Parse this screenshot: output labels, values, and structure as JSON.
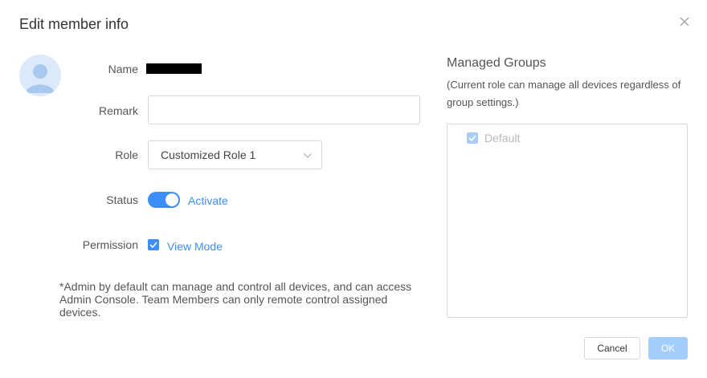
{
  "dialog": {
    "title": "Edit member info"
  },
  "form": {
    "name_label": "Name",
    "remark_label": "Remark",
    "remark_value": "",
    "role_label": "Role",
    "role_value": "Customized Role 1",
    "status_label": "Status",
    "status_text": "Activate",
    "status_on": true,
    "permission_label": "Permission",
    "permission_text": "View Mode",
    "permission_checked": true,
    "note": "*Admin by default can manage and control all devices, and can access Admin Console. Team Members can only remote control assigned devices."
  },
  "groups": {
    "title": "Managed Groups",
    "subtitle": "(Current role can manage all devices regardless of group settings.)",
    "items": [
      {
        "label": "Default",
        "checked": true,
        "disabled": true
      }
    ]
  },
  "footer": {
    "cancel_label": "Cancel",
    "ok_label": "OK"
  },
  "colors": {
    "accent": "#3d8ef8",
    "ok_disabled": "#a3cdfb",
    "avatar_bg": "#dbe9fb"
  }
}
